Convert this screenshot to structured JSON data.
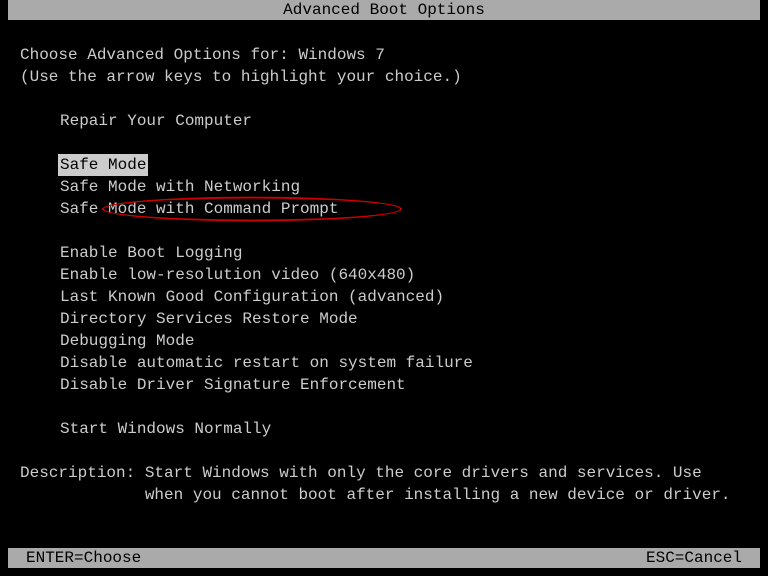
{
  "title": "Advanced Boot Options",
  "heading": "Choose Advanced Options for: Windows 7",
  "subheading": "(Use the arrow keys to highlight your choice.)",
  "menu": {
    "group1": [
      "Repair Your Computer"
    ],
    "group2": [
      "Safe Mode",
      "Safe Mode with Networking",
      "Safe Mode with Command Prompt"
    ],
    "group3": [
      "Enable Boot Logging",
      "Enable low-resolution video (640x480)",
      "Last Known Good Configuration (advanced)",
      "Directory Services Restore Mode",
      "Debugging Mode",
      "Disable automatic restart on system failure",
      "Disable Driver Signature Enforcement"
    ],
    "group4": [
      "Start Windows Normally"
    ]
  },
  "selected_item": "Safe Mode",
  "circled_item": "Safe Mode with Command Prompt",
  "description_label": "Description: ",
  "description_line1": "Start Windows with only the core drivers and services. Use",
  "description_line2": "when you cannot boot after installing a new device or driver.",
  "footer": {
    "left": "ENTER=Choose",
    "right": "ESC=Cancel"
  }
}
